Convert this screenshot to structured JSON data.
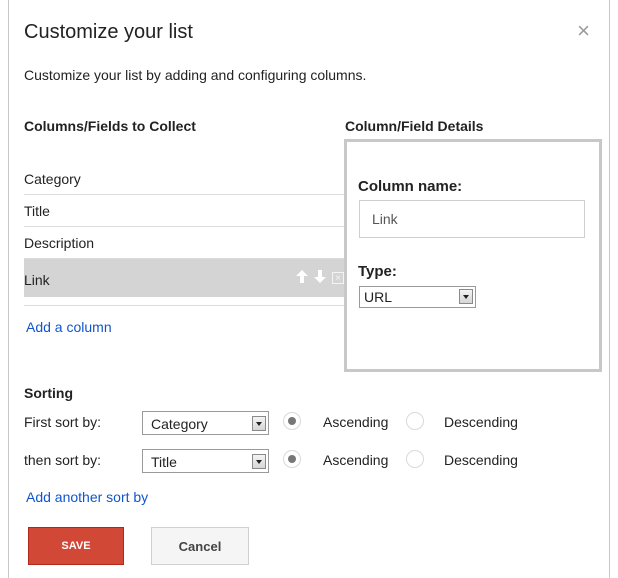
{
  "dialog": {
    "title": "Customize your list",
    "close_icon": "×",
    "description": "Customize your list by adding and configuring columns."
  },
  "columns": {
    "heading": "Columns/Fields to Collect",
    "items": [
      {
        "label": "Category"
      },
      {
        "label": "Title"
      },
      {
        "label": "Description"
      },
      {
        "label": "Link",
        "selected": true
      }
    ],
    "row_actions": {
      "up_icon": "🡅",
      "down_icon": "🡇",
      "delete_icon": "×"
    },
    "add_label": "Add a column"
  },
  "details": {
    "heading": "Column/Field Details",
    "name_label": "Column name:",
    "name_value": "Link",
    "type_label": "Type:",
    "type_value": "URL"
  },
  "sorting": {
    "heading": "Sorting",
    "rows": [
      {
        "label": "First sort by:",
        "value": "Category",
        "ascending_label": "Ascending",
        "descending_label": "Descending",
        "selected": "Ascending"
      },
      {
        "label": "then sort by:",
        "value": "Title",
        "ascending_label": "Ascending",
        "descending_label": "Descending",
        "selected": "Ascending"
      }
    ],
    "add_label": "Add another sort by"
  },
  "buttons": {
    "save_label": "SAVE",
    "cancel_label": "Cancel"
  },
  "colors": {
    "link": "#1155cc",
    "save_bg": "#d14836",
    "selected_row": "#d4d4d4",
    "details_border": "#c8c8c8"
  }
}
